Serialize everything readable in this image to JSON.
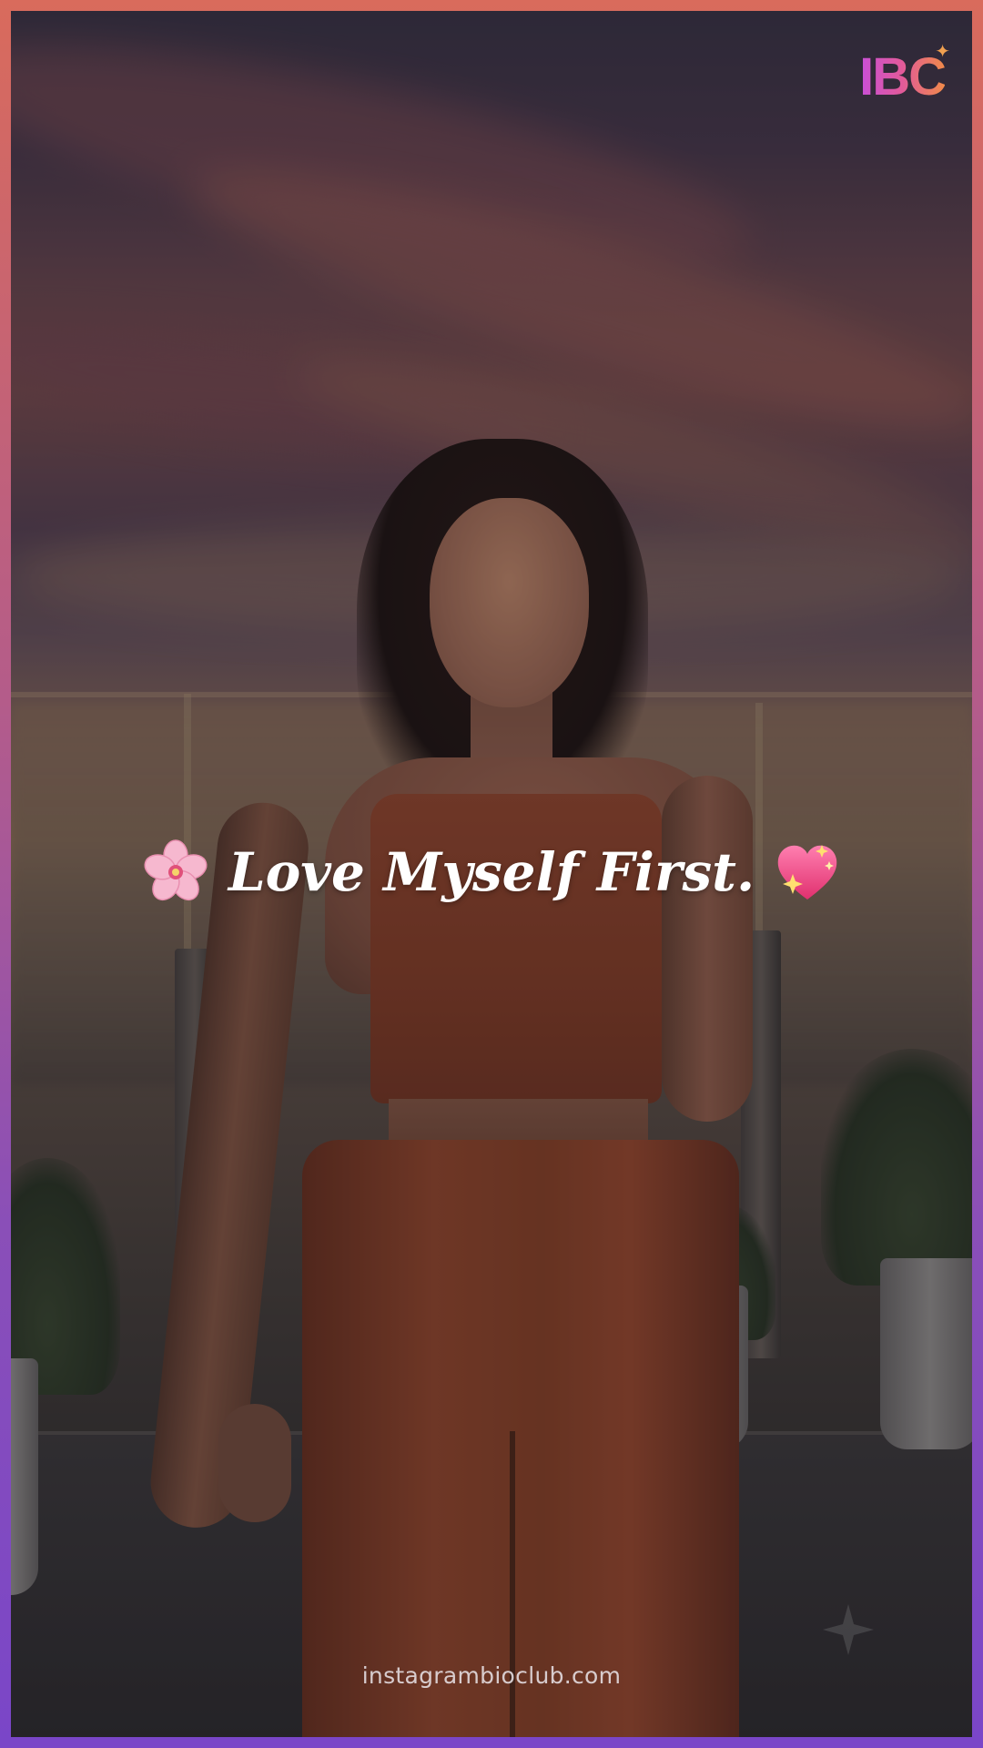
{
  "logo": {
    "text": "IBC",
    "colors": [
      "#c84fd8",
      "#e25a9a",
      "#f08a4a"
    ]
  },
  "caption": {
    "leading_icon": "cherry-blossom-emoji",
    "text": "Love Myself First.",
    "trailing_icon": "sparkling-heart-emoji"
  },
  "footer": {
    "url": "instagrambioclub.com"
  },
  "border_colors": [
    "#d96b5c",
    "#b45c8a",
    "#7a46c8"
  ]
}
